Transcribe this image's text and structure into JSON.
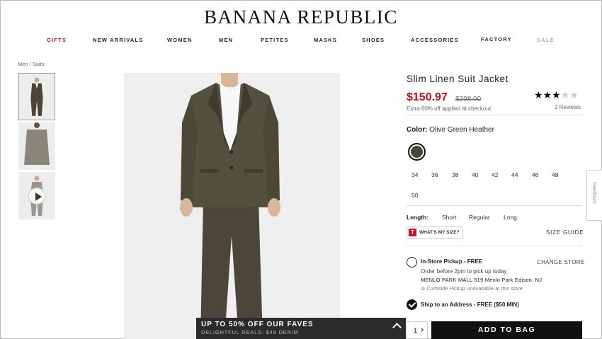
{
  "brand": {
    "logo": "BANANA REPUBLIC"
  },
  "nav": [
    {
      "label": "GIFTS"
    },
    {
      "label": "NEW ARRIVALS"
    },
    {
      "label": "WOMEN"
    },
    {
      "label": "MEN"
    },
    {
      "label": "PETITES"
    },
    {
      "label": "MASKS"
    },
    {
      "label": "SHOES"
    },
    {
      "label": "ACCESSORIES"
    },
    {
      "label": "FACTORY"
    },
    {
      "label": "SALE"
    }
  ],
  "breadcrumb": "Men / Suits",
  "product": {
    "name": "Slim Linen Suit Jacket",
    "price": "$150.97",
    "old_price": "$298.00",
    "promo_note": "Extra 60% off applied at checkout",
    "rating": 3,
    "rating_max": 5,
    "reviews": "2 Reviews",
    "color_label": "Color:",
    "color_value": "Olive Green Heather",
    "swatch_color": "#4a4538",
    "sizes": [
      "34",
      "36",
      "38",
      "40",
      "42",
      "44",
      "46",
      "48",
      "50"
    ],
    "length_label": "Length:",
    "lengths": [
      "Short",
      "Regular",
      "Long"
    ],
    "whats_my_size": "WHAT'S MY SIZE?",
    "whats_my_size_icon": "T",
    "size_guide": "SIZE GUIDE"
  },
  "fulfillment": {
    "pickup_title": "In-Store Pickup - FREE",
    "change_store": "CHANGE STORE",
    "pickup_line1": "Order before 2pm to pick up today",
    "pickup_line2": "MENLO PARK MALL 519 Menlo Park  Edison, NJ",
    "pickup_line3": "⊘ Curbside Pickup unavailable at this store",
    "ship_title": "Ship to an Address - FREE ($50 MIN)"
  },
  "cart": {
    "qty": "1",
    "add_to_bag": "ADD TO BAG"
  },
  "promo_banner": {
    "title": "UP TO 50% OFF OUR FAVES",
    "subtitle": "DELIGHTFUL DEALS: $49 DENIM"
  },
  "feedback_tab": "Feedback",
  "colors": {
    "sale_red": "#b5111f",
    "suit": "#4a4538"
  }
}
